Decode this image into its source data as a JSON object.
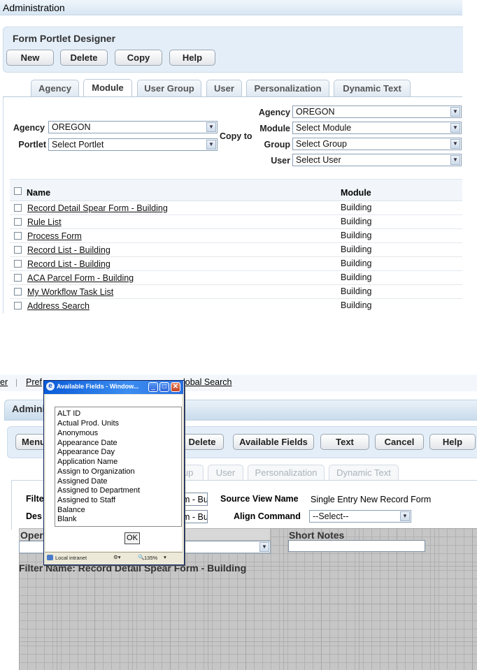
{
  "top": {
    "admin_title": "Administration",
    "panel_title": "Form Portlet Designer",
    "buttons": [
      "New",
      "Delete",
      "Copy",
      "Help"
    ],
    "tabs": [
      "Agency",
      "Module",
      "User Group",
      "User",
      "Personalization",
      "Dynamic Text"
    ],
    "active_tab": "Module",
    "fields": {
      "agency_label": "Agency",
      "agency_value": "OREGON",
      "portlet_label": "Portlet",
      "portlet_value": "Select Portlet",
      "copy_to_label": "Copy to",
      "copy_agency_label": "Agency",
      "copy_agency_value": "OREGON",
      "copy_module_label": "Module",
      "copy_module_value": "Select Module",
      "copy_group_label": "Group",
      "copy_group_value": "Select Group",
      "copy_user_label": "User",
      "copy_user_value": "Select User"
    },
    "table": {
      "headers": [
        "Name",
        "Module"
      ],
      "rows": [
        {
          "name": "Record Detail Spear Form - Building",
          "module": "Building"
        },
        {
          "name": "Rule List",
          "module": "Building"
        },
        {
          "name": "Process Form",
          "module": "Building"
        },
        {
          "name": "Record List - Building",
          "module": "Building"
        },
        {
          "name": "Record List - Building",
          "module": "Building"
        },
        {
          "name": "ACA Parcel Form - Building",
          "module": "Building"
        },
        {
          "name": "My Workflow Task List",
          "module": "Building"
        },
        {
          "name": "Address Search",
          "module": "Building"
        }
      ]
    }
  },
  "bottom": {
    "nav": {
      "left_fragment": "er",
      "pref_fragment": "Pref",
      "global_search_fragment": "lobal Search"
    },
    "admin_fragment": "Admini",
    "buttons": {
      "menu_fragment": "Menu",
      "delete": "Delete",
      "available_fields": "Available Fields",
      "text": "Text",
      "cancel": "Cancel",
      "help": "Help"
    },
    "tabs": {
      "group_fragment": "oup",
      "user": "User",
      "personalization": "Personalization",
      "dynamic_text": "Dynamic Text"
    },
    "fields": {
      "filter_fragment": "Filte",
      "des_fragment": "Des",
      "filter_value_fragment": "m - Bu",
      "des_value_fragment": "m - Bu",
      "source_view_label": "Source View Name",
      "source_view_value": "Single Entry New Record Form",
      "align_label": "Align Command",
      "align_value": "--Select--",
      "oper_fragment": "Oper",
      "short_notes_label": "Short Notes"
    },
    "filter_name": "Filter Name: Record Detail Spear Form - Building"
  },
  "popup": {
    "title": "Available Fields - Window...",
    "items": [
      "ALT ID",
      "Actual Prod. Units",
      "Anonymous",
      "Appearance Date",
      "Appearance Day",
      "Application Name",
      "Assign to Organization",
      "Assigned Date",
      "Assigned to Department",
      "Assigned to Staff",
      "Balance",
      "Blank"
    ],
    "ok": "OK",
    "status_zone": "Local intranet",
    "zoom": "135%"
  }
}
